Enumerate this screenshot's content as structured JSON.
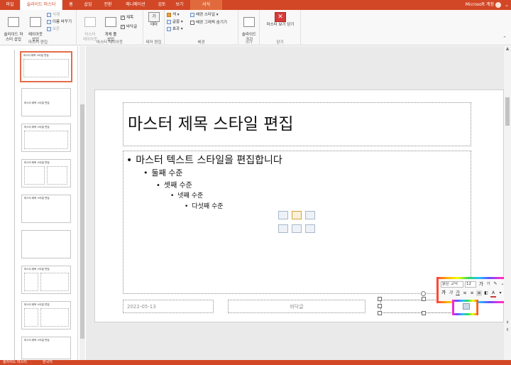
{
  "tabs": [
    "파일",
    "슬라이드 마스터",
    "홈",
    "삽입",
    "전환",
    "애니메이션",
    "검토",
    "보기",
    "서식"
  ],
  "active_tab": "슬라이드 마스터",
  "account_label": "Microsoft 계정",
  "ribbon": {
    "groups": {
      "master_edit": "마스터 편집",
      "master_layout": "마스터 레이아웃",
      "theme_edit": "테마 편집",
      "background": "배경",
      "size": "크기",
      "close": "닫기"
    },
    "insert_master": "슬라이드 마\n스터 삽입",
    "insert_layout": "레이아웃\n삽입",
    "delete": "삭제",
    "rename": "이름 바꾸기",
    "preserve": "보존",
    "master_layout_btn": "마스터\n레이아웃",
    "insert_placeholder": "개체 틀\n삽입",
    "title_check": "제목",
    "footer_check": "바닥글",
    "themes": "테마",
    "theme_icon_text": "가",
    "colors": "색",
    "fonts": "글꼴",
    "effects": "효과",
    "background_styles": "배경 스타일",
    "hide_bg_graphics": "배경 그래픽 숨기기",
    "slide_size": "슬라이드\n크기",
    "close_master": "마스터 보기 닫기",
    "close_icon": "✕"
  },
  "thumbnails": {
    "master_title": "마스터 제목 스타일 편집",
    "layout_titles": [
      "마스터 제목 스타일 편집",
      "마스터 제목 스타일 편집",
      "마스터 제목 스타일 편집",
      "마스터 제목 스타일 편집",
      "마스터 제목 스타일 편집",
      "",
      "마스터 제목 스타일 편집",
      "마스터 제목 스타일 편집",
      "마스터 제목 스타일 편집"
    ]
  },
  "slide": {
    "title": "마스터 제목 스타일 편집",
    "levels": [
      "마스터 텍스트 스타일을 편집합니다",
      "둘째 수준",
      "셋째 수준",
      "넷째 수준",
      "다섯째 수준"
    ],
    "date": "2022-05-13",
    "footer": "바닥글",
    "page_number": "‹#›"
  },
  "mini_toolbar": {
    "font": "맑은 고딕",
    "size": "12",
    "grow": "가",
    "shrink": "가",
    "bold": "가",
    "italic": "가",
    "underline": "가"
  },
  "status": {
    "view": "슬라이드 마스터",
    "language": "한국어"
  },
  "colors": {
    "accent": "#d24726",
    "selected_thumbnail": "#e46c4a"
  }
}
